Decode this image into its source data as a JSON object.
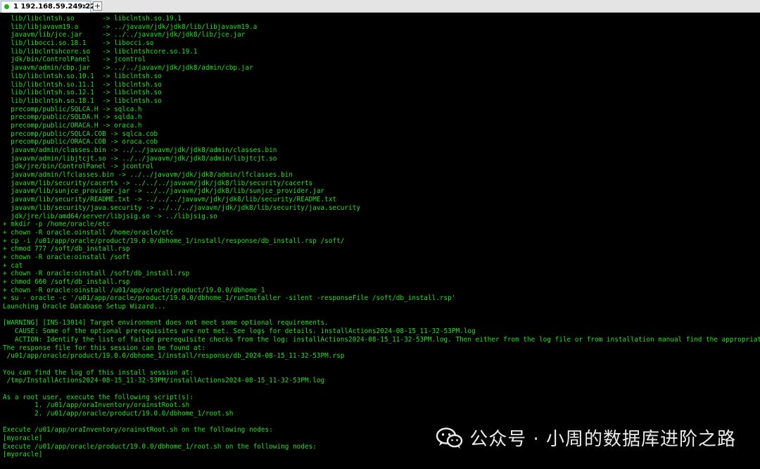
{
  "tab": {
    "label": "1 192.168.59.249:22",
    "close": "×",
    "new": "+"
  },
  "terminal": {
    "lines": [
      "  lib/libclntsh.so       -> libclntsh.so.19.1",
      "  lib/libjavavm19.a      -> ../javavm/jdk/jdk8/lib/libjavavm19.a",
      "  javavm/lib/jce.jar     -> ../../javavm/jdk/jdk8/lib/jce.jar",
      "  lib/libocci.so.18.1    -> libocci.so",
      "  lib/libclntshcore.so   -> libclntshcore.so.19.1",
      "  jdk/bin/ControlPanel   -> jcontrol",
      "  javavm/admin/cbp.jar   -> ../../javavm/jdk/jdk8/admin/cbp.jar",
      "  lib/libclntsh.so.10.1  -> libclntsh.so",
      "  lib/libclntsh.so.11.1  -> libclntsh.so",
      "  lib/libclntsh.so.12.1  -> libclntsh.so",
      "  lib/libclntsh.so.18.1  -> libclntsh.so",
      "  precomp/public/SQLCA.H -> sqlca.h",
      "  precomp/public/SQLDA.H -> sqlda.h",
      "  precomp/public/ORACA.H -> oraca.h",
      "  precomp/public/SQLCA.COB -> sqlca.cob",
      "  precomp/public/ORACA.COB -> oraca.cob",
      "  javavm/admin/classes.bin -> ../../javavm/jdk/jdk8/admin/classes.bin",
      "  javavm/admin/libjtcjt.so -> ../../javavm/jdk/jdk8/admin/libjtcjt.so",
      "  jdk/jre/bin/ControlPanel -> jcontrol",
      "  javavm/admin/lfclasses.bin -> ../../javavm/jdk/jdk8/admin/lfclasses.bin",
      "  javavm/lib/security/cacerts -> ../../../javavm/jdk/jdk8/lib/security/cacerts",
      "  javavm/lib/sunjce_provider.jar -> ../../javavm/jdk/jdk8/lib/sunjce_provider.jar",
      "  javavm/lib/security/README.txt -> ../../../javavm/jdk/jdk8/lib/security/README.txt",
      "  javavm/lib/security/java.security -> ../../../javavm/jdk/jdk8/lib/security/java.security",
      "  jdk/jre/lib/amd64/server/libjsig.so -> ../libjsig.so",
      "+ mkdir -p /home/oracle/etc",
      "+ chown -R oracle.oinstall /home/oracle/etc",
      "+ cp -i /u01/app/oracle/product/19.0.0/dbhome_1/install/response/db_install.rsp /soft/",
      "+ chmod 777 /soft/db_install.rsp",
      "+ chown -R oracle:oinstall /soft",
      "+ cat",
      "+ chown -R oracle:oinstall /soft/db_install.rsp",
      "+ chmod 660 /soft/db_install.rsp",
      "+ chown -R oracle:oinstall /u01/app/oracle/product/19.0.0/dbhome_1",
      "+ su - oracle -c '/u01/app/oracle/product/19.0.0/dbhome_1/runInstaller -silent -responseFile /soft/db_install.rsp'",
      "Launching Oracle Database Setup Wizard...",
      "",
      "[WARNING] [INS-13014] Target environment does not meet some optional requirements.",
      "   CAUSE: Some of the optional prerequisites are not met. See logs for details. installActions2024-08-15_11-32-53PM.log",
      "   ACTION: Identify the list of failed prerequisite checks from the log: installActions2024-08-15_11-32-53PM.log. Then either from the log file or from installation manual find the appropriate con",
      "The response file for this session can be found at:",
      " /u01/app/oracle/product/19.0.0/dbhome_1/install/response/db_2024-08-15_11-32-53PM.rsp",
      "",
      "You can find the log of this install session at:",
      " /tmp/InstallActions2024-08-15_11-32-53PM/installActions2024-08-15_11-32-53PM.log",
      "",
      "As a root user, execute the following script(s):",
      "        1. /u01/app/oraInventory/orainstRoot.sh",
      "        2. /u01/app/oracle/product/19.0.0/dbhome_1/root.sh",
      "",
      "Execute /u01/app/oraInventory/orainstRoot.sh on the following nodes:",
      "[myoracle]",
      "Execute /u01/app/oracle/product/19.0.0/dbhome_1/root.sh on the following nodes:",
      "[myoracle]"
    ]
  },
  "watermark": {
    "text": "公众号 · 小周的数据库进阶之路",
    "icon": "wechat-icon"
  },
  "colors": {
    "terminal_bg": "#000000",
    "terminal_fg": "#22e022",
    "tab_bg": "#e4e4e4",
    "status_dot": "#1db41d"
  }
}
